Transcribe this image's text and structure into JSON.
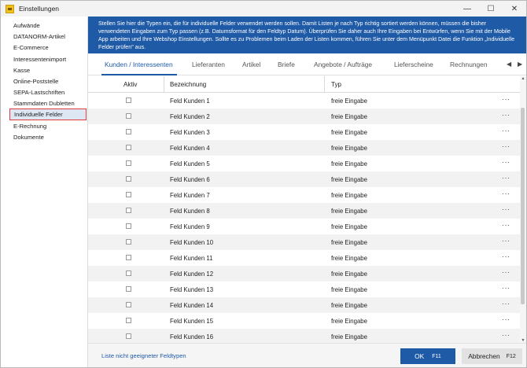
{
  "window": {
    "title": "Einstellungen",
    "icon": "app-folder-icon",
    "controls": {
      "minimize": "—",
      "maximize": "☐",
      "close": "✕"
    }
  },
  "sidebar": {
    "items": [
      {
        "label": "Aufwände"
      },
      {
        "label": "DATANORM-Artikel"
      },
      {
        "label": "E-Commerce"
      },
      {
        "label": "Interessentenimport"
      },
      {
        "label": "Kasse"
      },
      {
        "label": "Online-Poststelle"
      },
      {
        "label": "SEPA-Lastschriften"
      },
      {
        "label": "Stammdaten Dubletten"
      },
      {
        "label": "Individuelle Felder",
        "selected": true
      },
      {
        "label": "E-Rechnung"
      },
      {
        "label": "Dokumente"
      }
    ]
  },
  "info": {
    "text": "Stellen Sie hier die Typen ein, die für individuelle Felder verwendet werden sollen. Damit Listen je nach Typ richtig sortiert werden können, müssen die bisher verwendeten Eingaben zum Typ passen (z.B. Datumsformat für den Feldtyp Datum). Überprüfen Sie daher auch Ihre Eingaben bei Entwürfen, wenn Sie mit der Mobile App arbeiten und Ihre Webshop Einstellungen. Sollte es zu Problemen beim Laden der Listen kommen, führen Sie unter dem Menüpunkt Datei die Funktion „Individuelle Felder prüfen\" aus."
  },
  "tabs": {
    "items": [
      {
        "label": "Kunden / Interessenten",
        "active": true
      },
      {
        "label": "Lieferanten"
      },
      {
        "label": "Artikel"
      },
      {
        "label": "Briefe"
      },
      {
        "label": "Angebote / Aufträge"
      },
      {
        "label": "Lieferscheine"
      },
      {
        "label": "Rechnungen"
      }
    ],
    "prev_arrow": "◀",
    "next_arrow": "▶"
  },
  "table": {
    "columns": {
      "active": "Aktiv",
      "name": "Bezeichnung",
      "type": "Typ"
    },
    "rows": [
      {
        "name": "Feld Kunden 1",
        "type": "freie Eingabe",
        "checked": false
      },
      {
        "name": "Feld Kunden 2",
        "type": "freie Eingabe",
        "checked": false
      },
      {
        "name": "Feld Kunden 3",
        "type": "freie Eingabe",
        "checked": false
      },
      {
        "name": "Feld Kunden 4",
        "type": "freie Eingabe",
        "checked": false
      },
      {
        "name": "Feld Kunden 5",
        "type": "freie Eingabe",
        "checked": false
      },
      {
        "name": "Feld Kunden 6",
        "type": "freie Eingabe",
        "checked": false
      },
      {
        "name": "Feld Kunden 7",
        "type": "freie Eingabe",
        "checked": false
      },
      {
        "name": "Feld Kunden 8",
        "type": "freie Eingabe",
        "checked": false
      },
      {
        "name": "Feld Kunden 9",
        "type": "freie Eingabe",
        "checked": false
      },
      {
        "name": "Feld Kunden 10",
        "type": "freie Eingabe",
        "checked": false
      },
      {
        "name": "Feld Kunden 11",
        "type": "freie Eingabe",
        "checked": false
      },
      {
        "name": "Feld Kunden 12",
        "type": "freie Eingabe",
        "checked": false
      },
      {
        "name": "Feld Kunden 13",
        "type": "freie Eingabe",
        "checked": false
      },
      {
        "name": "Feld Kunden 14",
        "type": "freie Eingabe",
        "checked": false
      },
      {
        "name": "Feld Kunden 15",
        "type": "freie Eingabe",
        "checked": false
      },
      {
        "name": "Feld Kunden 16",
        "type": "freie Eingabe",
        "checked": false
      }
    ],
    "row_action": "···"
  },
  "footer": {
    "link": "Liste nicht geeigneter Feldtypen",
    "ok_label": "OK",
    "ok_key": "F11",
    "cancel_label": "Abbrechen",
    "cancel_key": "F12"
  },
  "colors": {
    "accent": "#1f5aa6",
    "selection_border": "#e03a3a",
    "selection_fill": "#dde6f3",
    "row_alt": "#f2f2f2"
  }
}
